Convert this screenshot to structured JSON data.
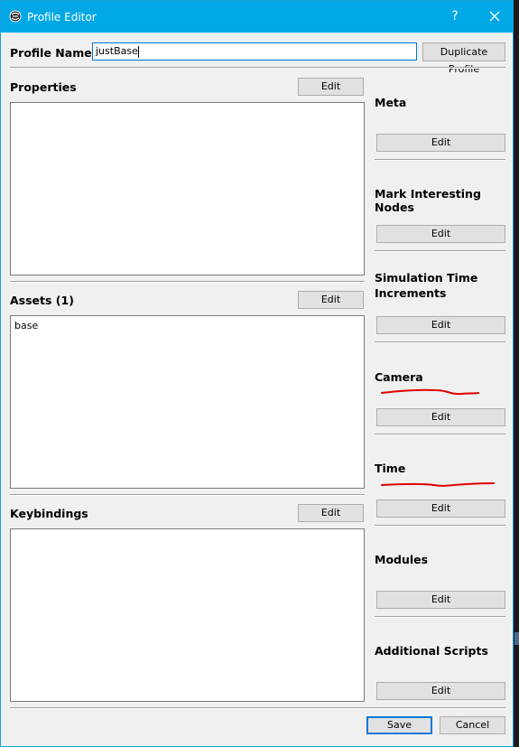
{
  "window": {
    "title": "Profile Editor",
    "help_glyph": "?"
  },
  "profile": {
    "label": "Profile Name:",
    "value": "justBase",
    "duplicate_label": "Duplicate Profile"
  },
  "sections": {
    "properties": {
      "label": "Properties",
      "edit_label": "Edit",
      "items": []
    },
    "assets": {
      "label": "Assets (1)",
      "edit_label": "Edit",
      "items": [
        "base"
      ]
    },
    "keybindings": {
      "label": "Keybindings",
      "edit_label": "Edit",
      "items": []
    }
  },
  "right_panel": [
    {
      "label": "Meta",
      "edit_label": "Edit"
    },
    {
      "label": "Mark Interesting Nodes",
      "edit_label": "Edit"
    },
    {
      "label": "Simulation Time",
      "label2": "Increments",
      "edit_label": "Edit"
    },
    {
      "label": "Camera",
      "edit_label": "Edit",
      "annotated": true
    },
    {
      "label": "Time",
      "edit_label": "Edit",
      "annotated": true
    },
    {
      "label": "Modules",
      "edit_label": "Edit"
    },
    {
      "label": "Additional Scripts",
      "edit_label": "Edit"
    }
  ],
  "footer": {
    "save_label": "Save",
    "cancel_label": "Cancel"
  },
  "colors": {
    "titlebar": "#00a9e6",
    "annotation": "#e00000",
    "accent": "#0078d7"
  },
  "icons": {
    "app": "openspace-icon",
    "close": "close-icon"
  }
}
